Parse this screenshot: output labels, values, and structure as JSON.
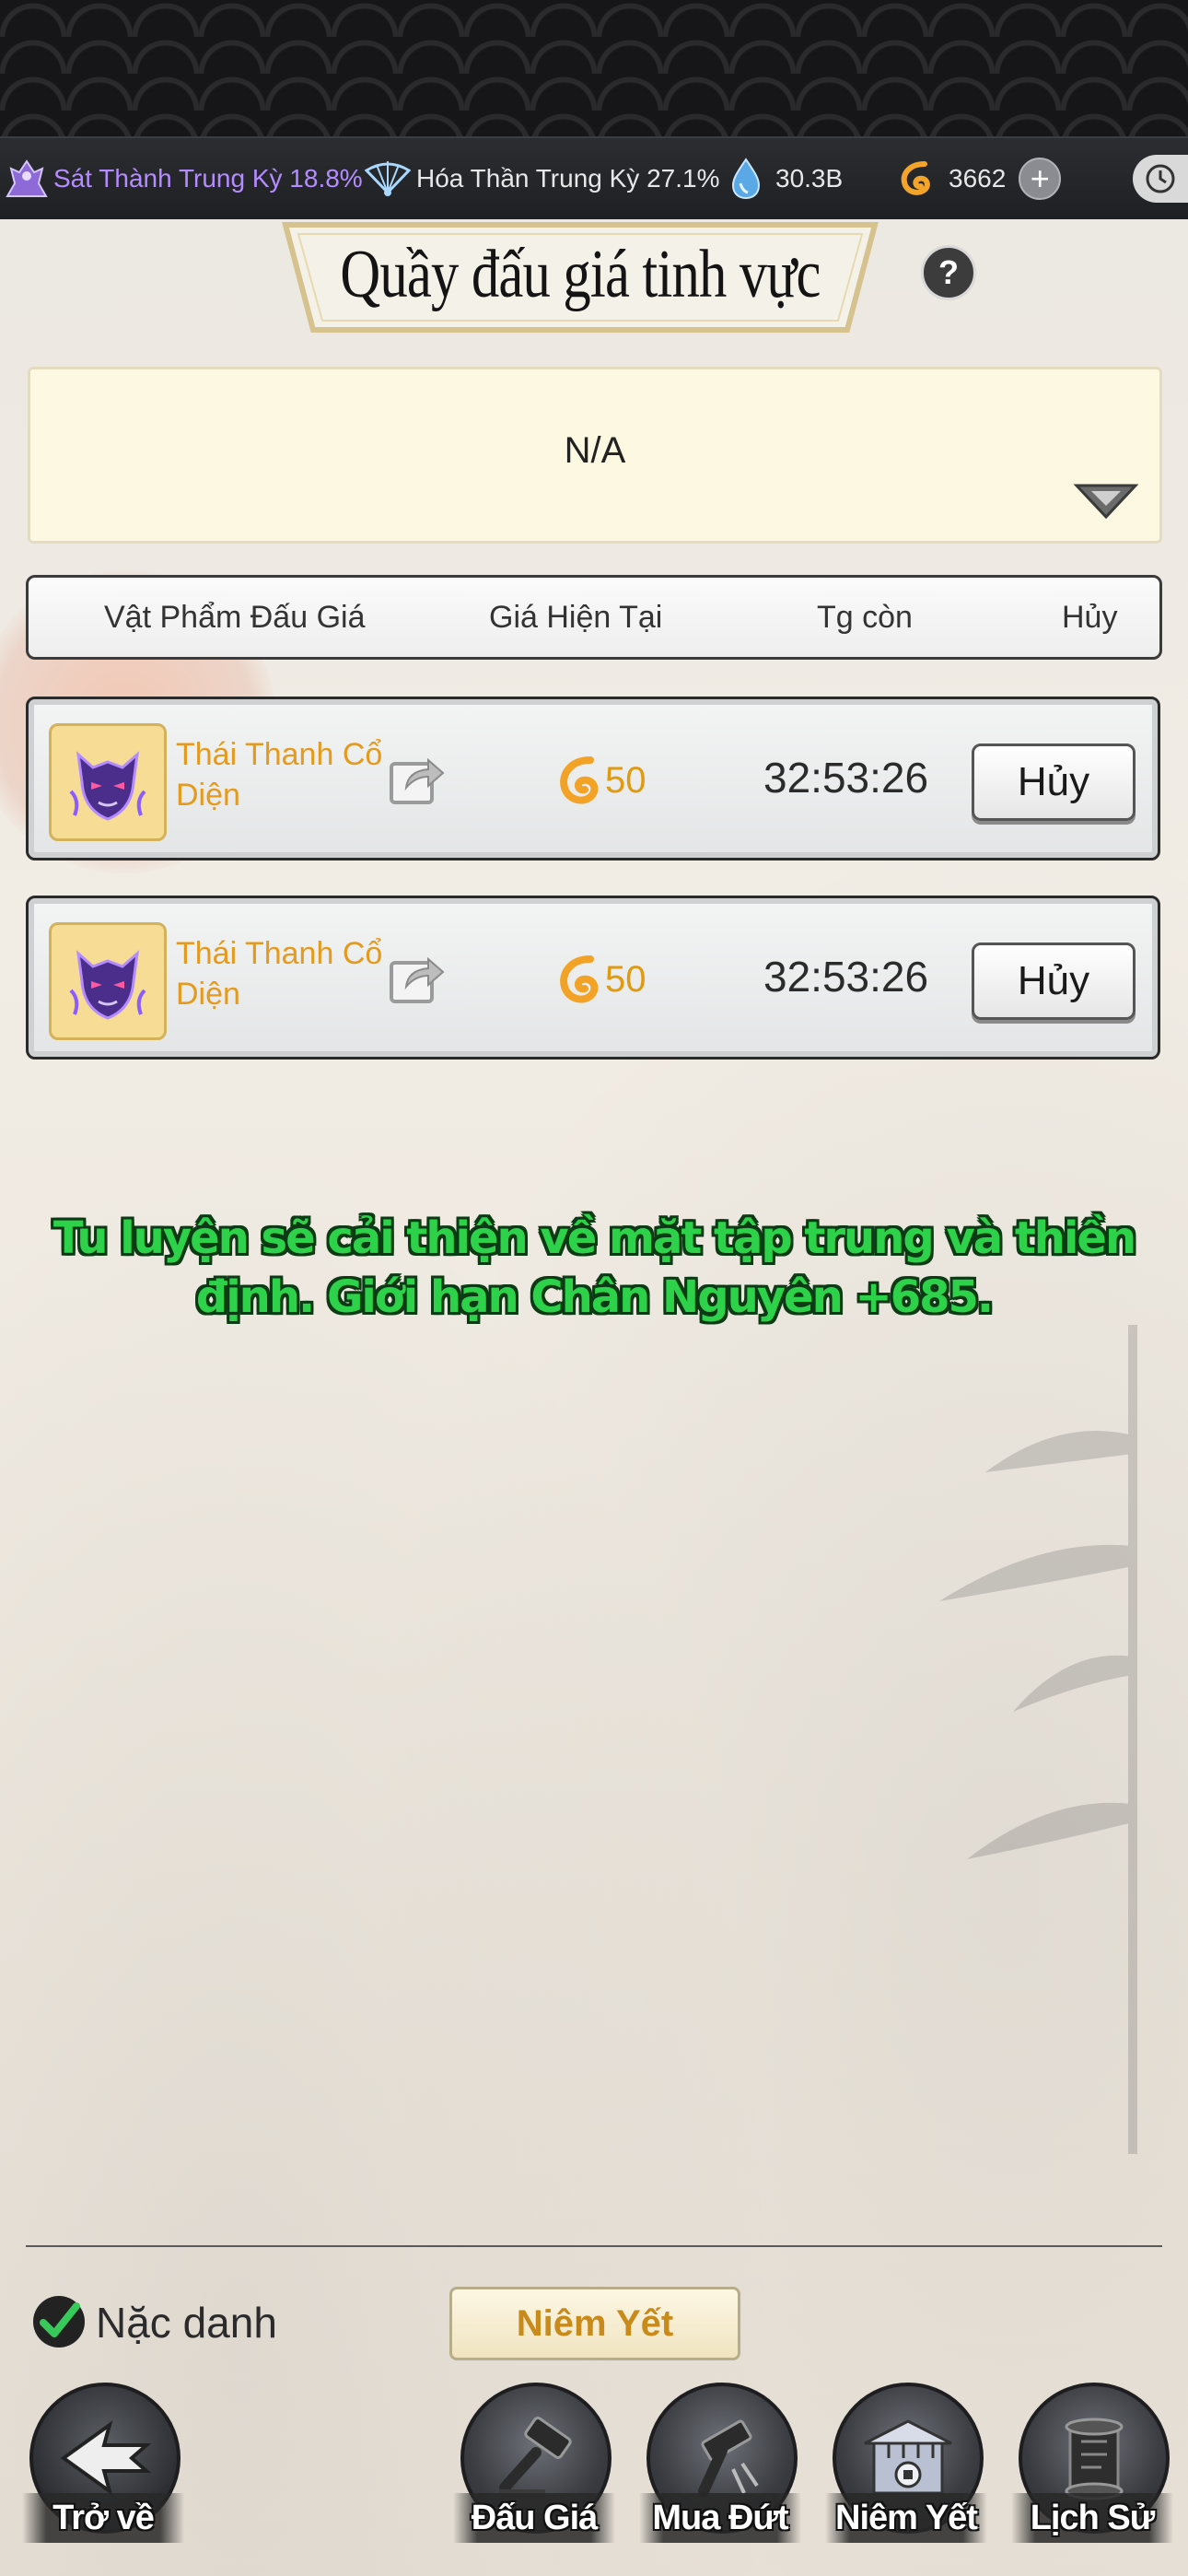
{
  "status_bar": {
    "stat1_text": "Sát Thành Trung Kỳ 18.8%",
    "stat2_text": "Hóa Thần Trung Kỳ 27.1%",
    "crystal_value": "30.3B",
    "currency_value": "3662",
    "plus_label": "+"
  },
  "header": {
    "title": "Quầy đấu giá tinh vực",
    "help_label": "?"
  },
  "filter": {
    "value": "N/A"
  },
  "columns": [
    "Vật Phẩm Đấu Giá",
    "Giá Hiện Tại",
    "Tg còn",
    "Hủy"
  ],
  "rows": [
    {
      "name": "Thái Thanh Cổ Diện",
      "price": "50",
      "time_left": "32:53:26",
      "cancel_label": "Hủy"
    },
    {
      "name": "Thái Thanh Cổ Diện",
      "price": "50",
      "time_left": "32:53:26",
      "cancel_label": "Hủy"
    }
  ],
  "notice": "Tu luyện sẽ cải thiện về mặt tập trung và thiền định. Giới hạn Chân Nguyên +685.",
  "footer": {
    "anonymous_label": "Nặc danh",
    "anonymous_checked": true,
    "list_button_label": "Niêm Yết"
  },
  "nav": {
    "back": "Trở về",
    "auction": "Đấu Giá",
    "buyout": "Mua Đứt",
    "listing": "Niêm Yết",
    "history": "Lịch Sử"
  },
  "colors": {
    "notice_green": "#2ed24a",
    "item_name_orange": "#e59a1d",
    "stat_purple": "#b58cff"
  }
}
